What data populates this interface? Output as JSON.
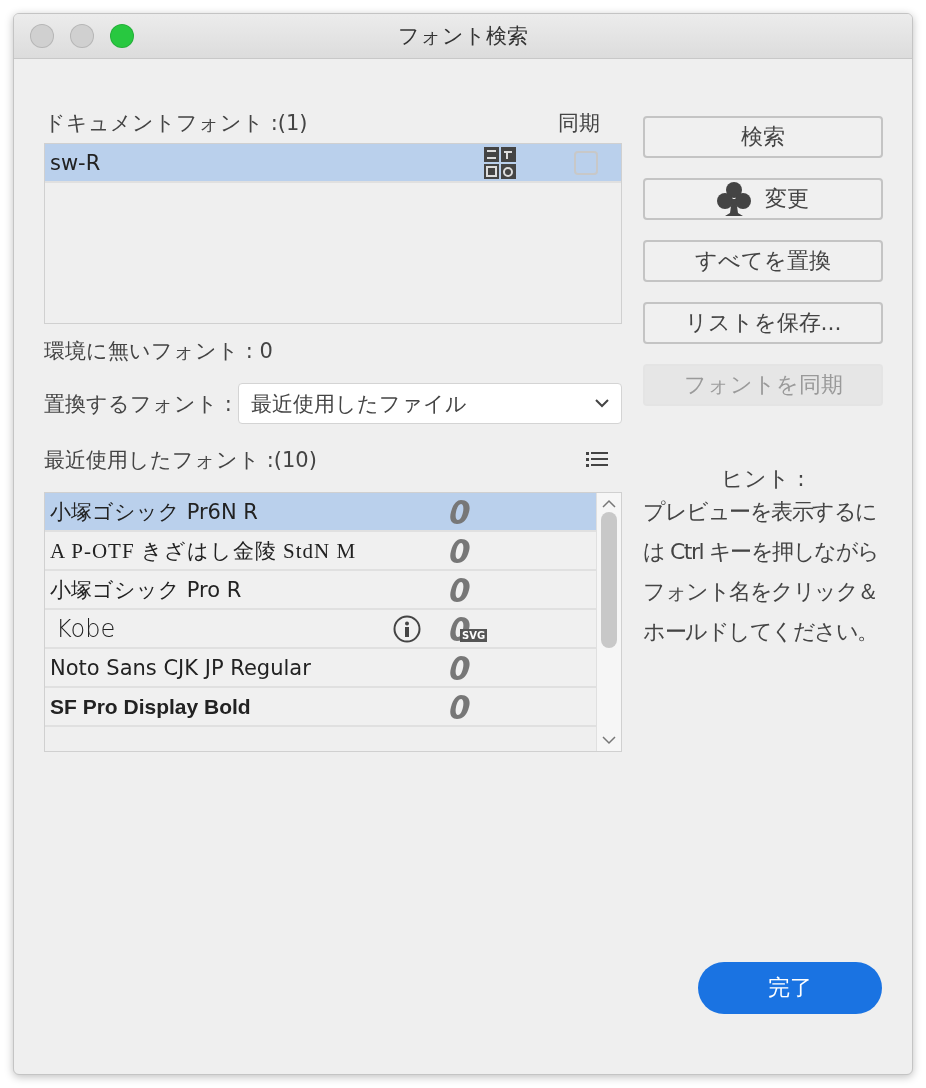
{
  "window": {
    "title": "フォント検索",
    "controls": [
      {
        "kind": "close",
        "active": false
      },
      {
        "kind": "minimize",
        "active": false
      },
      {
        "kind": "zoom",
        "active": true
      }
    ]
  },
  "document_fonts": {
    "label": "ドキュメントフォント :(1)",
    "sync_label": "同期",
    "rows": [
      {
        "name": "sw-R",
        "selected": true,
        "checked": false
      }
    ]
  },
  "missing_fonts": "環境に無いフォント : 0",
  "replace": {
    "label": "置換するフォント :",
    "value": "最近使用したファイル"
  },
  "recent_fonts": {
    "label": "最近使用したフォント :(10)",
    "rows": [
      {
        "name": "小塚ゴシック Pr6N R",
        "selected": true,
        "info": false,
        "kind": "opentype"
      },
      {
        "name": "A P-OTF きざはし金陵 StdN M",
        "selected": false,
        "info": false,
        "kind": "opentype"
      },
      {
        "name": "小塚ゴシック Pro R",
        "selected": false,
        "info": false,
        "kind": "opentype"
      },
      {
        "name": "Kobe",
        "selected": false,
        "info": true,
        "kind": "svg",
        "badge": "SVG"
      },
      {
        "name": "Noto Sans CJK JP Regular",
        "selected": false,
        "info": false,
        "kind": "opentype"
      },
      {
        "name": "SF Pro Display Bold",
        "selected": false,
        "info": false,
        "kind": "opentype"
      }
    ]
  },
  "buttons": [
    {
      "label": "検索",
      "icon": false,
      "disabled": false
    },
    {
      "label": "変更",
      "icon": true,
      "disabled": false
    },
    {
      "label": "すべてを置換",
      "icon": false,
      "disabled": false
    },
    {
      "label": "リストを保存...",
      "icon": false,
      "disabled": false
    },
    {
      "label": "フォントを同期",
      "icon": false,
      "disabled": true
    }
  ],
  "hint": {
    "title": "ヒント :",
    "text": "プレビューを表示するには Ctrl キーを押しながらフォント名をクリック＆ホールドしてください。"
  },
  "done_button": "完了"
}
